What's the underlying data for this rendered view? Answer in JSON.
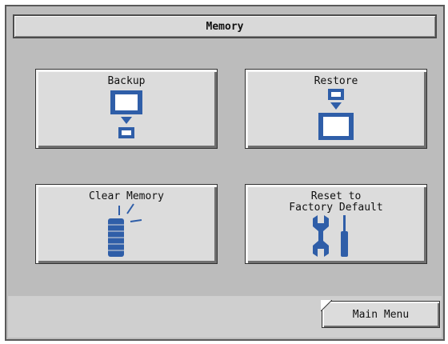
{
  "title": "Memory",
  "tiles": [
    {
      "label": "Backup",
      "icon": "backup-icon"
    },
    {
      "label": "Restore",
      "icon": "restore-icon"
    },
    {
      "label": "Clear Memory",
      "icon": "clear-memory-icon"
    },
    {
      "label": "Reset to\nFactory Default",
      "icon": "reset-tools-icon"
    }
  ],
  "footer": {
    "main_menu_label": "Main Menu"
  },
  "colors": {
    "icon_blue": "#2f5ea8",
    "panel_gray": "#bcbcbc",
    "button_gray": "#dcdcdc"
  }
}
